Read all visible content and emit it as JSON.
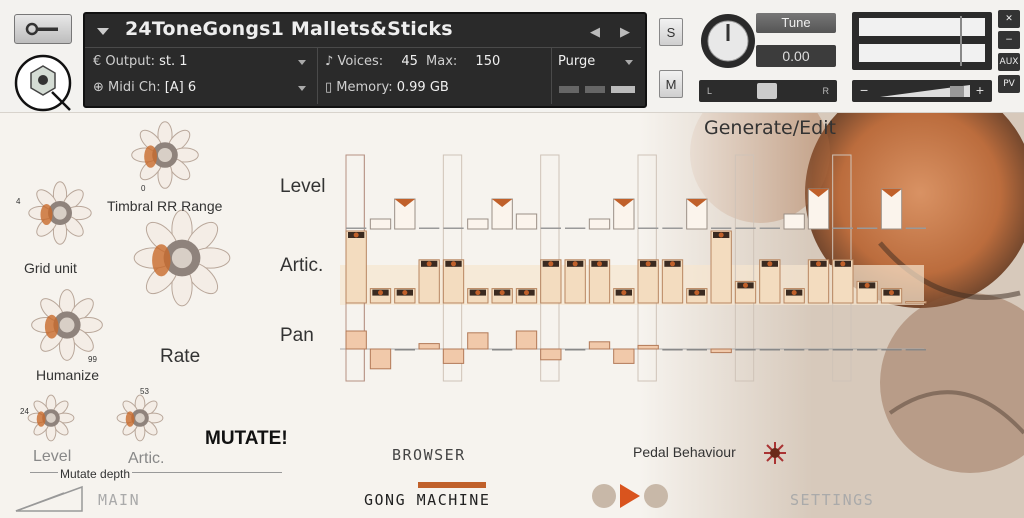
{
  "header": {
    "instrument_name": "24ToneGongs1 Mallets&Sticks",
    "output_label": "Output:",
    "output_value": "st. 1",
    "voices_label": "Voices:",
    "voices_value": "45",
    "max_label": "Max:",
    "max_value": "150",
    "purge_label": "Purge",
    "midi_label": "Midi Ch:",
    "midi_value": "[A]  6",
    "memory_label": "Memory:",
    "memory_value": "0.99 GB",
    "solo_label": "S",
    "mute_label": "M",
    "tune_label": "Tune",
    "tune_value": "0.00",
    "pan_left": "L",
    "pan_right": "R",
    "vol_minus": "−",
    "vol_plus": "+",
    "side_buttons": [
      "✕",
      "−",
      "AUX",
      "PV"
    ]
  },
  "main": {
    "generate_edit": "Generate/Edit",
    "timbral_rr_label": "Timbral RR Range",
    "timbral_rr_value": "0",
    "grid_unit_label": "Grid unit",
    "grid_unit_value": "4",
    "rate_label": "Rate",
    "humanize_label": "Humanize",
    "humanize_value": "99",
    "level_knob_value": "24",
    "artic_knob_value": "53",
    "level_label": "Level",
    "artic_label": "Artic.",
    "mutate_depth_label": "Mutate depth",
    "mutate_button": "MUTATE!",
    "row_labels": [
      "Level",
      "Artic.",
      "Pan"
    ],
    "browser_label": "BROWSER",
    "pedal_label": "Pedal Behaviour"
  },
  "sequencer": {
    "steps": 24,
    "level": [
      0,
      0.2,
      0.6,
      0,
      0,
      0.2,
      0.6,
      0.3,
      0,
      0,
      0.2,
      0.6,
      0,
      0,
      0.6,
      0,
      0,
      0,
      0.3,
      0.8,
      0,
      0,
      0.8,
      0
    ],
    "artic": [
      1.0,
      0.2,
      0.2,
      0.6,
      0.6,
      0.2,
      0.2,
      0.2,
      0.6,
      0.6,
      0.6,
      0.2,
      0.6,
      0.6,
      0.2,
      1.0,
      0.3,
      0.6,
      0.2,
      0.6,
      0.6,
      0.3,
      0.2,
      0
    ],
    "pan": [
      0.5,
      -0.55,
      0,
      0.15,
      -0.4,
      0.45,
      0,
      0.5,
      -0.3,
      0,
      0.2,
      -0.4,
      0.1,
      0,
      0,
      -0.1,
      0,
      0,
      0,
      0,
      0,
      0,
      0,
      0
    ],
    "highlight_columns": [
      0,
      4,
      8,
      12,
      16,
      20
    ]
  },
  "footer": {
    "tabs": [
      "MAIN",
      "GONG MACHINE",
      "SETTINGS"
    ]
  },
  "colors": {
    "accent": "#c0602a",
    "bar_fill": "#f3dcbf",
    "bar_stroke": "#b88660",
    "panel_bg": "#f6f3ee",
    "header_bg": "#2a2a2a"
  }
}
